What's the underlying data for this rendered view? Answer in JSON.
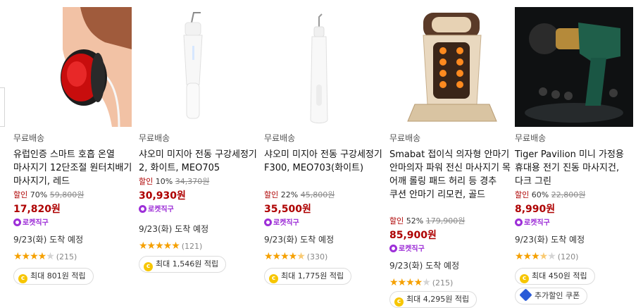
{
  "products": [
    {
      "shipping": "무료배송",
      "title": "유럽인증 스마트 호흡 온열 마사지기 12단조절 원터치배기 마사지기, 레드",
      "discount_label": "할인",
      "discount_rate": "70%",
      "original_price": "59,800원",
      "sale_price": "17,820원",
      "badge": "로켓직구",
      "arrival": "9/23(화) 도착 예정",
      "rating_stars": 4,
      "review_count": "(215)",
      "cashback": "최대 801원 적립"
    },
    {
      "shipping": "무료배송",
      "title": "샤오미 미지아 전동 구강세정기 2, 화이트, MEO705",
      "discount_label": "할인",
      "discount_rate": "10%",
      "original_price": "34,370원",
      "sale_price": "30,930원",
      "badge": "로켓직구",
      "arrival": "9/23(화) 도착 예정",
      "rating_stars": 5,
      "review_count": "(121)",
      "cashback": "최대 1,546원 적립"
    },
    {
      "shipping": "무료배송",
      "title": "샤오미 미지아 전동 구강세정기 F300, MEO703(화이트)",
      "discount_label": "할인",
      "discount_rate": "22%",
      "original_price": "45,800원",
      "sale_price": "35,500원",
      "badge": "로켓직구",
      "arrival": "9/23(화) 도착 예정",
      "rating_stars": 4.5,
      "review_count": "(330)",
      "cashback": "최대 1,775원 적립"
    },
    {
      "shipping": "무료배송",
      "title": "Smabat 접이식 의자형 안마기 안마의자 파워 전신 마사지기 목 어깨 롤링 패드 허리 등 경추 쿠션 안마기 리모컨, 골드",
      "discount_label": "할인",
      "discount_rate": "52%",
      "original_price": "179,900원",
      "sale_price": "85,900원",
      "badge": "로켓직구",
      "arrival": "9/23(화) 도착 예정",
      "rating_stars": 4,
      "review_count": "(215)",
      "cashback": "최대 4,295원 적립"
    },
    {
      "shipping": "무료배송",
      "title": "Tiger Pavilion 미니 가정용 휴대용 전기 진동 마사지건, 다크 그린",
      "discount_label": "할인",
      "discount_rate": "60%",
      "original_price": "22,800원",
      "sale_price": "8,990원",
      "badge": "로켓직구",
      "arrival": "9/23(화) 도착 예정",
      "rating_stars": 3.5,
      "review_count": "(120)",
      "cashback": "최대 450원 적립",
      "coupon": "추가할인 쿠폰"
    }
  ],
  "colors": {
    "discount_red": "#ae0000",
    "rocket_purple": "#9d2fd8",
    "star_orange": "#f5a000",
    "cash_yellow": "#f7c600",
    "coupon_blue": "#2a5bd7"
  },
  "icons": [
    "rocket-direct-icon",
    "star-icon",
    "cash-icon",
    "coupon-icon",
    "carousel-prev-arrow"
  ]
}
